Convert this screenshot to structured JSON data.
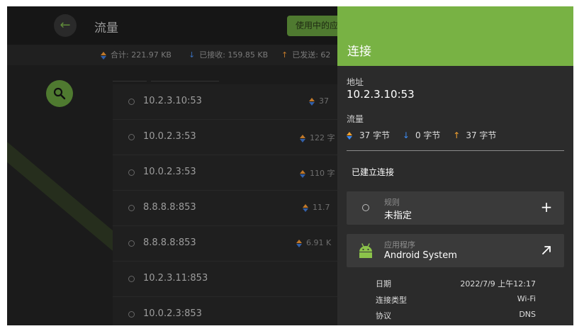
{
  "background_app": {
    "title": "流量",
    "filter_chip": "使用中的应",
    "stats": {
      "total": "合计: 221.97 KB",
      "received": "已接收: 159.85 KB",
      "sent": "已发送: 62"
    },
    "connections": [
      {
        "address": "10.2.3.10:53",
        "traffic": "37"
      },
      {
        "address": "10.0.2.3:53",
        "traffic": "122 字"
      },
      {
        "address": "10.0.2.3:53",
        "traffic": "110 字"
      },
      {
        "address": "8.8.8.8:853",
        "traffic": "11.7"
      },
      {
        "address": "8.8.8.8:853",
        "traffic": "6.91 K"
      },
      {
        "address": "10.2.3.11:853",
        "traffic": ""
      },
      {
        "address": "10.0.2.3:853",
        "traffic": ""
      }
    ]
  },
  "panel": {
    "title": "连接",
    "address_label": "地址",
    "address_value": "10.2.3.10:53",
    "traffic_label": "流量",
    "traffic_total": "37 字节",
    "traffic_received": "0 字节",
    "traffic_sent": "37 字节",
    "state": "已建立连接",
    "rule": {
      "caption": "规则",
      "value": "未指定"
    },
    "app": {
      "caption": "应用程序",
      "value": "Android System"
    },
    "meta": [
      {
        "key": "日期",
        "value": "2022/7/9 上午12:17"
      },
      {
        "key": "连接类型",
        "value": "Wi-Fi"
      },
      {
        "key": "协议",
        "value": "DNS"
      }
    ]
  },
  "colors": {
    "accent": "#78b244",
    "panel_bg": "#2b2b2b",
    "card_bg": "#3a3a3a",
    "download_arrow": "#3d8af0",
    "upload_arrow": "#f0a030",
    "android_green": "#8bc34a"
  },
  "icons": [
    "back-arrow-icon",
    "search-icon",
    "plus-icon",
    "open-external-icon",
    "android-icon"
  ]
}
